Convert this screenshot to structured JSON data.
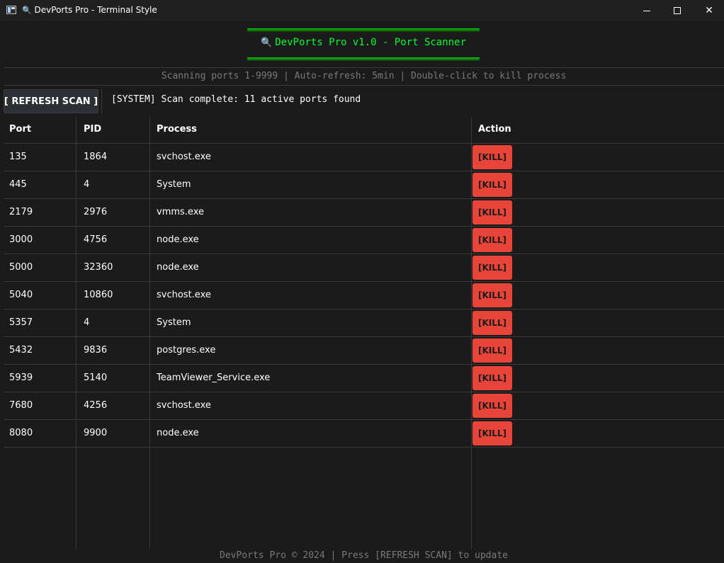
{
  "window": {
    "title": "DevPorts Pro - Terminal Style",
    "title_icon": "magnifier-icon",
    "controls": {
      "minimize": "minimize-icon",
      "maximize": "maximize-icon",
      "close": "✕"
    }
  },
  "header": {
    "icon": "🔍",
    "title": "DevPorts Pro v1.0 - Port Scanner",
    "accent": "#00ff33",
    "subtitle": "Scanning ports 1-9999 | Auto-refresh: 5min | Double-click to kill process"
  },
  "toolbar": {
    "refresh_label": "[ REFRESH SCAN ]",
    "status": "[SYSTEM] Scan complete: 11 active ports found"
  },
  "table": {
    "columns": [
      "Port",
      "PID",
      "Process",
      "Action"
    ],
    "kill_label": "[KILL]",
    "kill_color": "#e8443a",
    "rows": [
      {
        "port": "135",
        "pid": "1864",
        "process": "svchost.exe"
      },
      {
        "port": "445",
        "pid": "4",
        "process": "System"
      },
      {
        "port": "2179",
        "pid": "2976",
        "process": "vmms.exe"
      },
      {
        "port": "3000",
        "pid": "4756",
        "process": "node.exe"
      },
      {
        "port": "5000",
        "pid": "32360",
        "process": "node.exe"
      },
      {
        "port": "5040",
        "pid": "10860",
        "process": "svchost.exe"
      },
      {
        "port": "5357",
        "pid": "4",
        "process": "System"
      },
      {
        "port": "5432",
        "pid": "9836",
        "process": "postgres.exe"
      },
      {
        "port": "5939",
        "pid": "5140",
        "process": "TeamViewer_Service.exe"
      },
      {
        "port": "7680",
        "pid": "4256",
        "process": "svchost.exe"
      },
      {
        "port": "8080",
        "pid": "9900",
        "process": "node.exe"
      }
    ]
  },
  "footer": {
    "text": "DevPorts Pro © 2024 | Press [REFRESH SCAN] to update"
  }
}
